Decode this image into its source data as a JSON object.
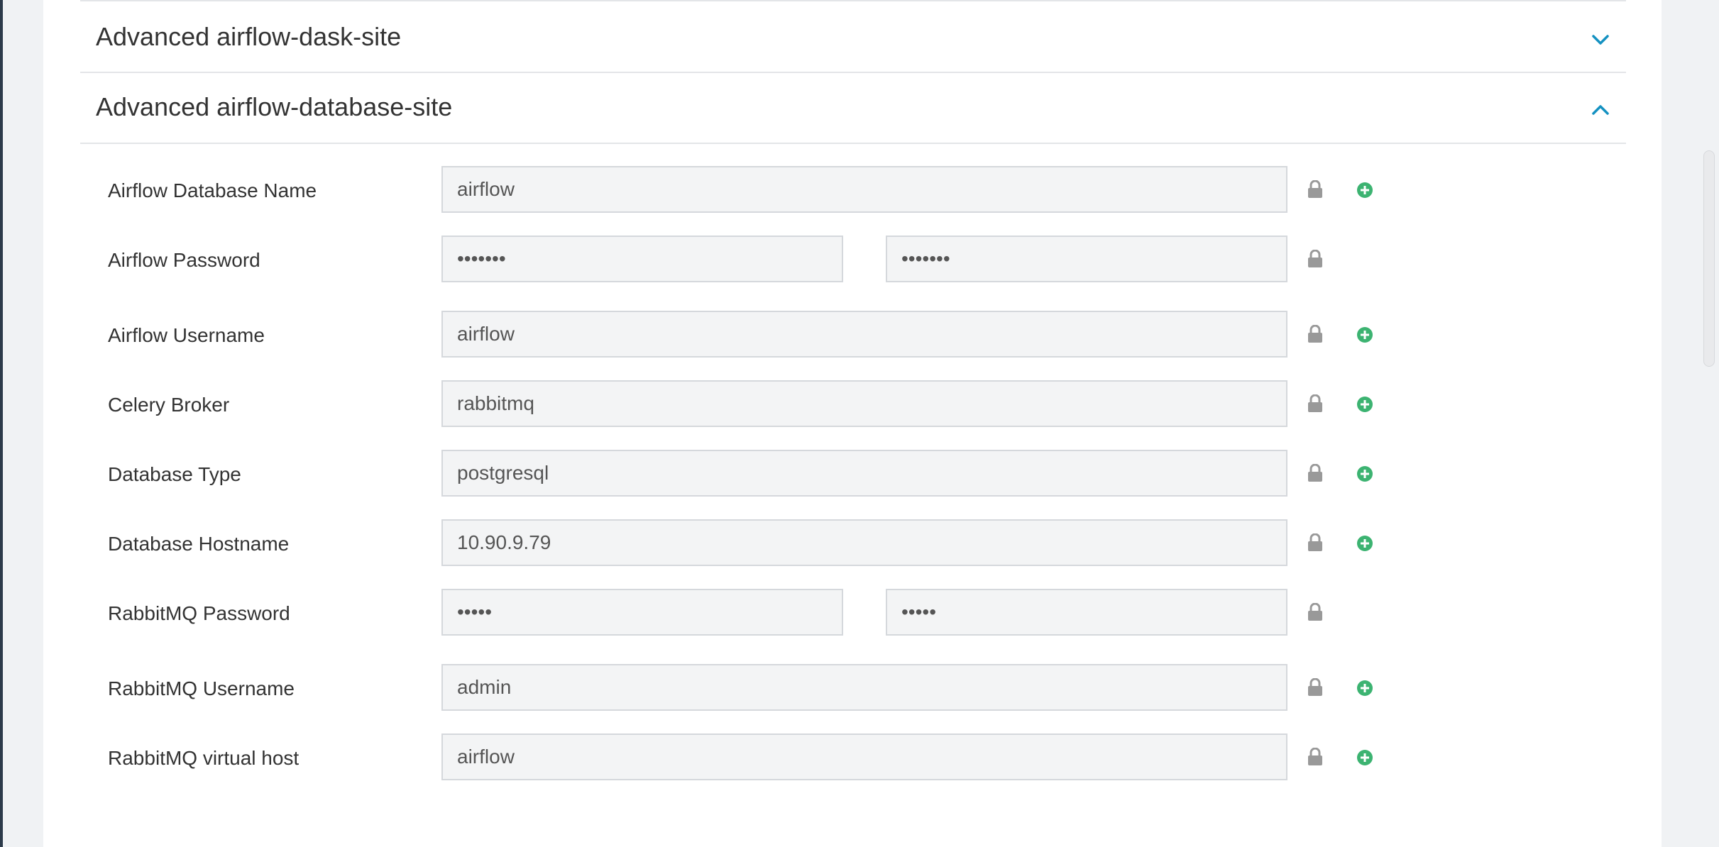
{
  "sections": [
    {
      "title": "Advanced airflow-dask-site",
      "icon": "chevron-down-icon",
      "expanded": false
    },
    {
      "title": "Advanced airflow-database-site",
      "icon": "chevron-up-icon",
      "expanded": true
    }
  ],
  "fields": [
    {
      "label": "Airflow Database Name",
      "value": "airflow",
      "type": "text",
      "has_add": true
    },
    {
      "label": "Airflow Password",
      "value": "•••••••",
      "confirm_value": "•••••••",
      "type": "password",
      "has_add": false
    },
    {
      "label": "Airflow Username",
      "value": "airflow",
      "type": "text",
      "has_add": true
    },
    {
      "label": "Celery Broker",
      "value": "rabbitmq",
      "type": "text",
      "has_add": true
    },
    {
      "label": "Database Type",
      "value": "postgresql",
      "type": "text",
      "has_add": true
    },
    {
      "label": "Database Hostname",
      "value": "10.90.9.79",
      "type": "text",
      "has_add": true
    },
    {
      "label": "RabbitMQ Password",
      "value": "•••••",
      "confirm_value": "•••••",
      "type": "password",
      "has_add": false
    },
    {
      "label": "RabbitMQ Username",
      "value": "admin",
      "type": "text",
      "has_add": true
    },
    {
      "label": "RabbitMQ virtual host",
      "value": "airflow",
      "type": "text",
      "has_add": true
    }
  ],
  "icons": {
    "lock": "lock-icon",
    "add": "plus-circle-icon"
  },
  "colors": {
    "accent": "#1491c1",
    "add_green": "#3cb371",
    "lock_gray": "#999999"
  }
}
